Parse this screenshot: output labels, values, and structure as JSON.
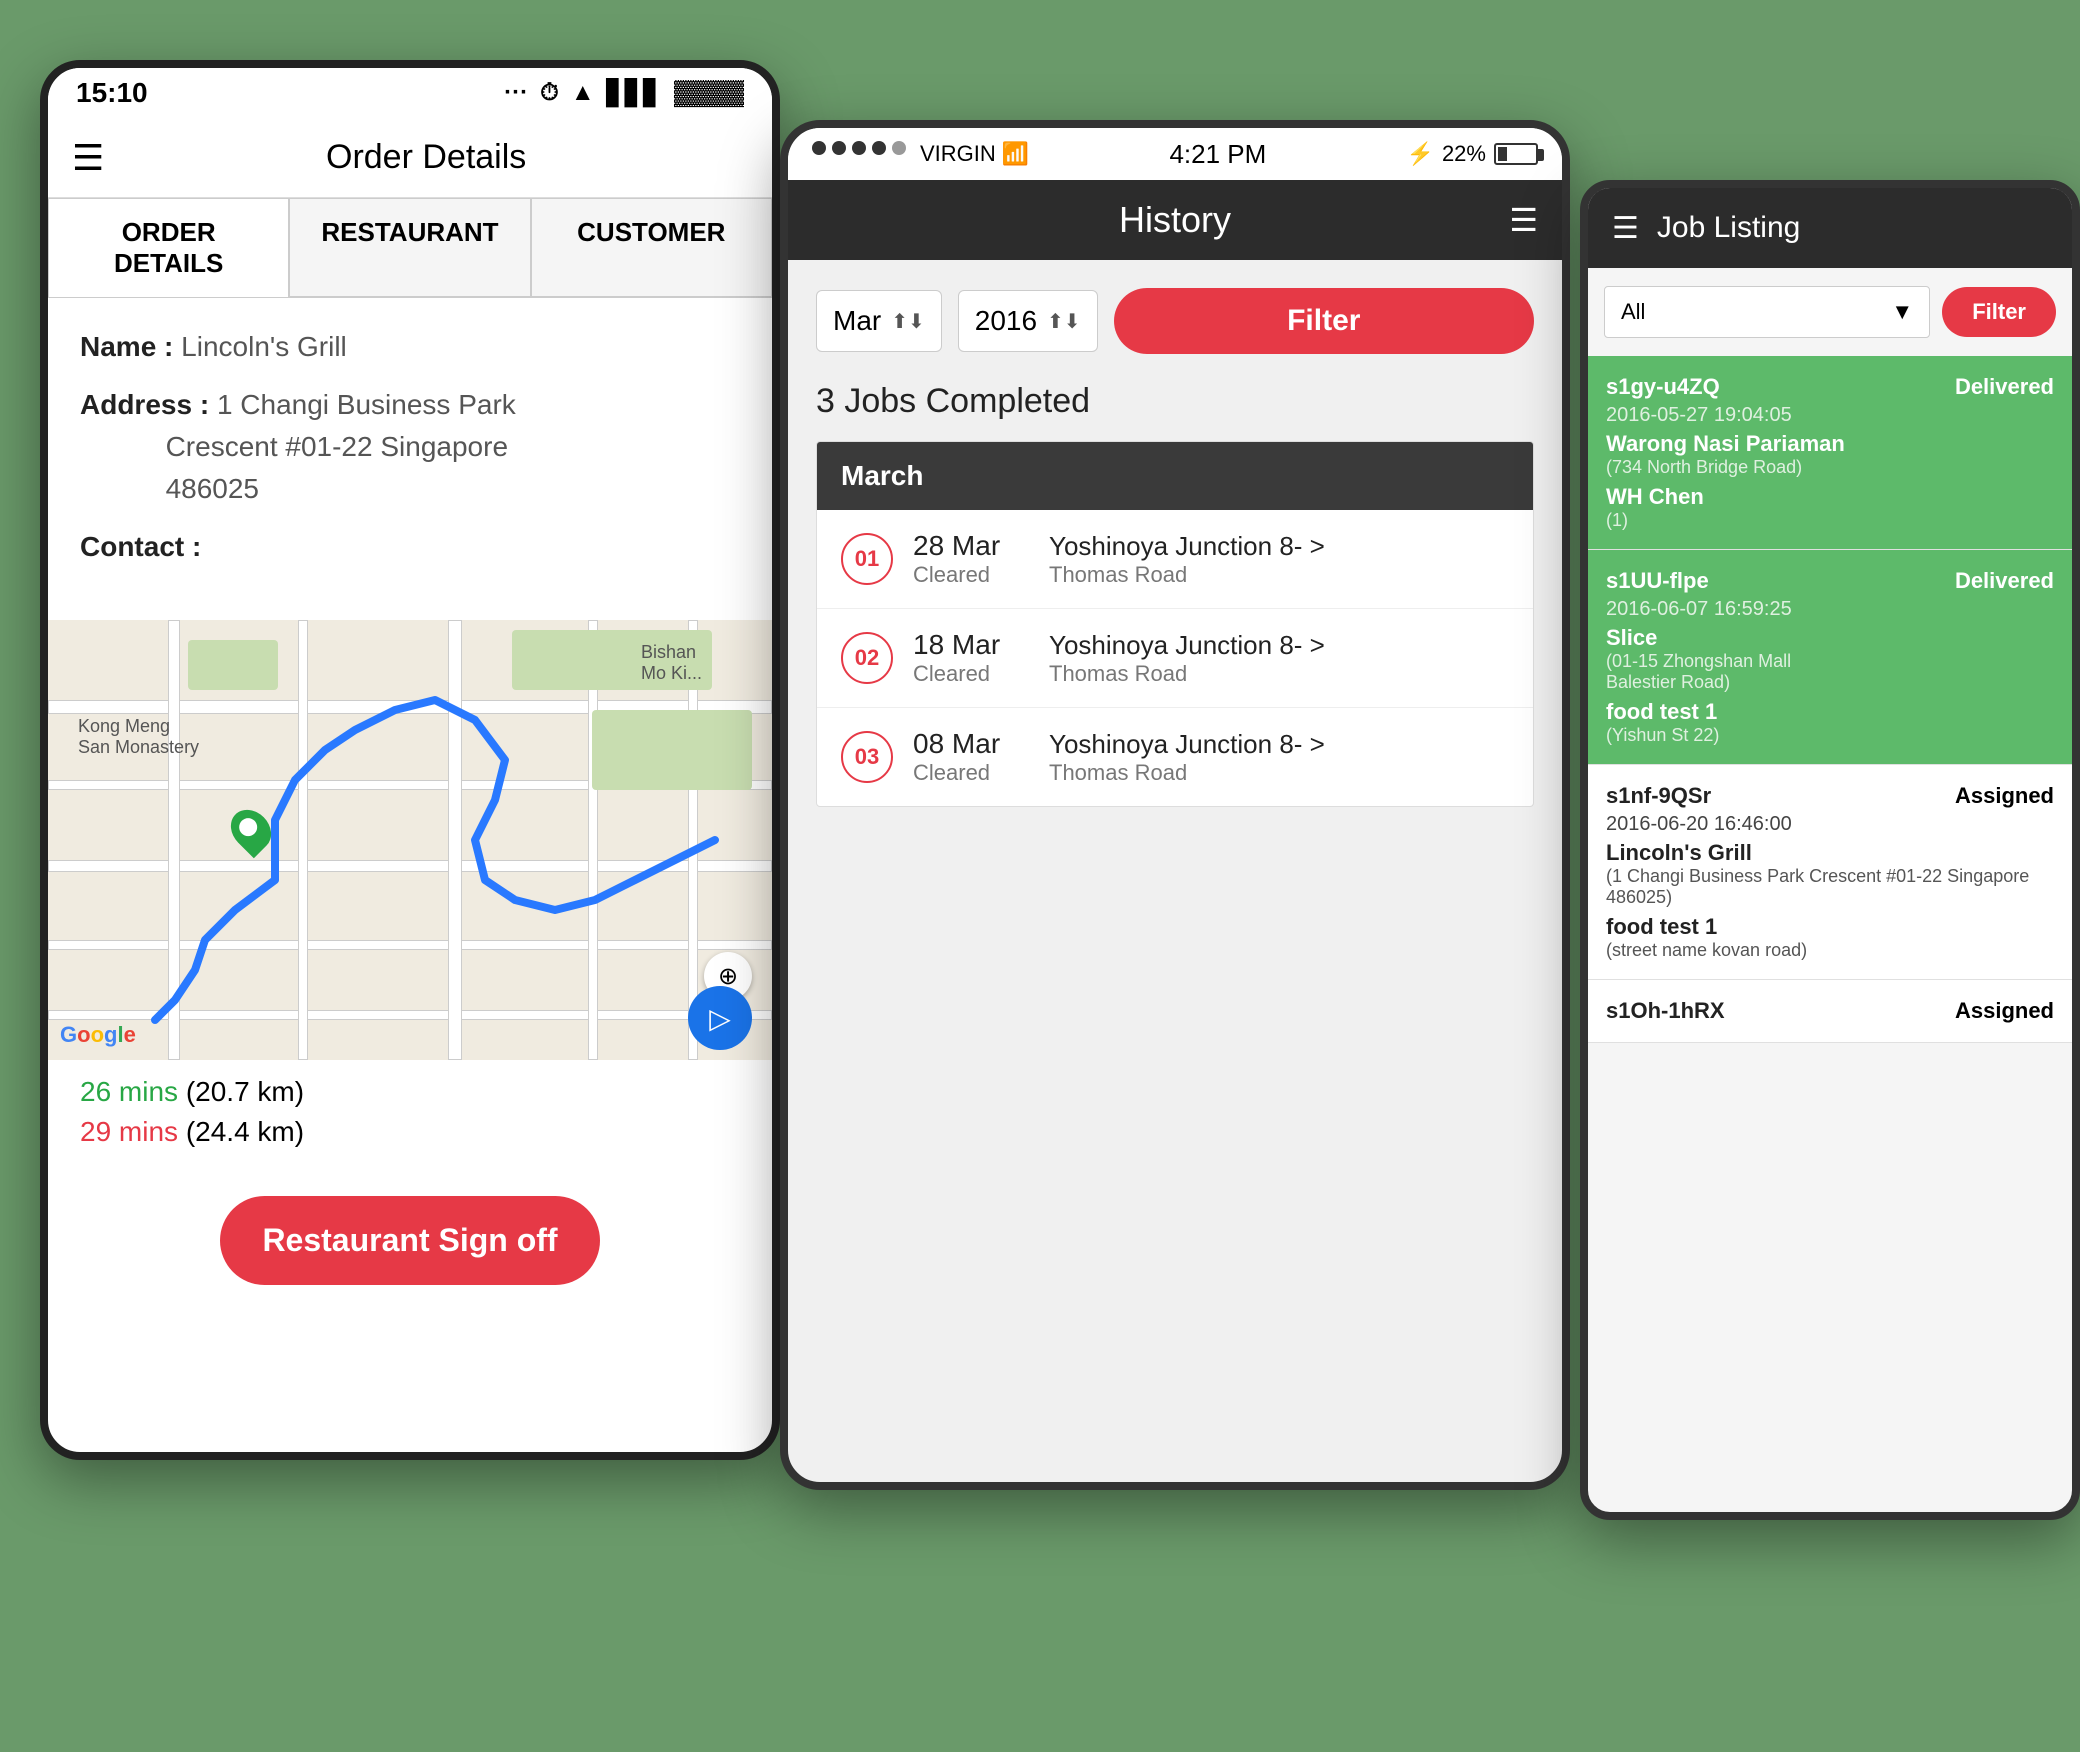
{
  "phone1": {
    "status_time": "15:10",
    "title": "Order Details",
    "tabs": [
      {
        "label": "ORDER\nDETAILS",
        "active": true
      },
      {
        "label": "RESTAURANT",
        "active": false
      },
      {
        "label": "CUSTOMER",
        "active": false
      }
    ],
    "name_label": "Name :",
    "name_value": " Lincoln's Grill",
    "address_label": "Address :",
    "address_value": "1 Changi Business Park Crescent #01-22 Singapore 486025",
    "contact_label": "Contact :",
    "route1_time": "26 mins",
    "route1_dist": "(20.7 km)",
    "route2_time": "29 mins",
    "route2_dist": "(24.4 km)",
    "google_label": "Google",
    "signoff_label": "Restaurant Sign off"
  },
  "phone2": {
    "carrier": "VIRGIN",
    "time": "4:21 PM",
    "battery_pct": "22%",
    "title": "History",
    "month_value": "Mar",
    "year_value": "2016",
    "filter_label": "Filter",
    "completed_text": "3 Jobs  Completed",
    "month_header": "March",
    "jobs": [
      {
        "num": "01",
        "date": "28 Mar",
        "status": "Cleared",
        "desc": "Yoshinoya Junction 8- >",
        "sub": "Thomas Road"
      },
      {
        "num": "02",
        "date": "18 Mar",
        "status": "Cleared",
        "desc": "Yoshinoya Junction 8- >",
        "sub": "Thomas Road"
      },
      {
        "num": "03",
        "date": "08 Mar",
        "status": "Cleared",
        "desc": "Yoshinoya Junction 8- >",
        "sub": "Thomas Road"
      }
    ]
  },
  "phone3": {
    "title": "Job Listing",
    "filter_placeholder": "All",
    "filter_label": "Filter",
    "jobs": [
      {
        "id": "s1gy-u4ZQ",
        "status": "Delivered",
        "date": "2016-05-27 19:04:05",
        "restaurant": "Warong Nasi Pariaman",
        "restaurant_addr": "(734 North Bridge Road)",
        "customer": "WH Chen",
        "customer_sub": "(1)",
        "green": true
      },
      {
        "id": "s1UU-flpe",
        "status": "Delivered",
        "date": "2016-06-07 16:59:25",
        "restaurant": "Slice",
        "restaurant_addr": "(01-15 Zhongshan Mall\nBalestier Road)",
        "customer": "food test 1",
        "customer_sub": "(Yishun St 22)",
        "green": true
      },
      {
        "id": "s1nf-9QSr",
        "status": "Assigned",
        "date": "2016-06-20 16:46:00",
        "restaurant": "Lincoln's Grill",
        "restaurant_addr": "(1 Changi Business Park Crescent #01-22 Singapore 486025)",
        "customer": "food test 1",
        "customer_sub": "(street name kovan road)",
        "green": false
      },
      {
        "id": "s1Oh-1hRX",
        "status": "Assigned",
        "date": "",
        "restaurant": "",
        "restaurant_addr": "",
        "customer": "",
        "customer_sub": "",
        "green": false
      }
    ]
  }
}
